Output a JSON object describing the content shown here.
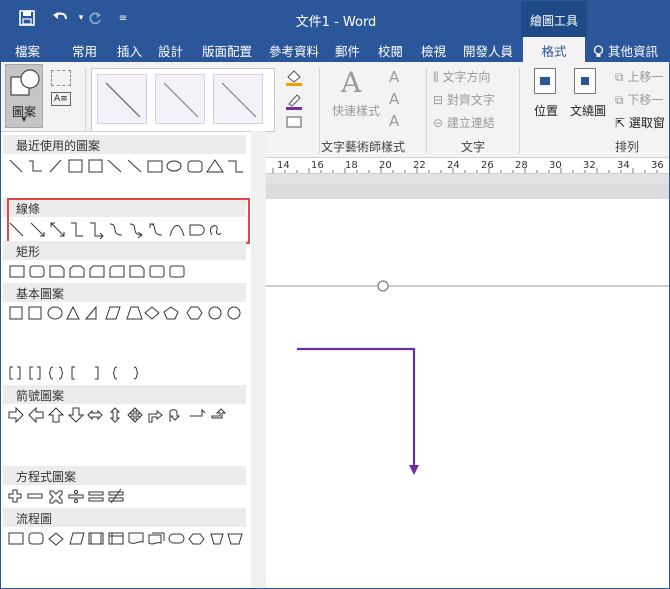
{
  "titlebar": {
    "doc_title": "文件1 - Word",
    "context_header": "繪圖工具"
  },
  "tabs": [
    "檔案",
    "常用",
    "插入",
    "設計",
    "版面配置",
    "參考資料",
    "郵件",
    "校閱",
    "檢視",
    "開發人員"
  ],
  "context_tab": "格式",
  "tell_me": "其他資訊",
  "ribbon": {
    "shape_button": "圖案",
    "quick_styles": "快速樣式",
    "text_direction": "文字方向",
    "align_text": "對齊文字",
    "create_link": "建立連結",
    "position": "位置",
    "wrap_text": "文繞圖",
    "bring_forward": "上移一",
    "send_backward": "下移一",
    "selection_pane": "選取窗",
    "group_wordart": "文字藝術師樣式",
    "group_text": "文字",
    "group_arrange": "排列"
  },
  "ruler": [
    "14",
    "16",
    "18",
    "20",
    "22",
    "24",
    "26",
    "28",
    "30",
    "32",
    "34",
    "36"
  ],
  "panel": {
    "sections": [
      "最近使用的圖案",
      "線條",
      "矩形",
      "基本圖案",
      "箭號圖案",
      "方程式圖案",
      "流程圖"
    ]
  },
  "colors": {
    "accent": "#2b579a",
    "drawn_line": "#6b2fa0",
    "highlight_box": "#e04848"
  },
  "icons": [
    "save-icon",
    "undo-icon",
    "redo-icon",
    "customize-icon",
    "lightbulb-icon"
  ]
}
